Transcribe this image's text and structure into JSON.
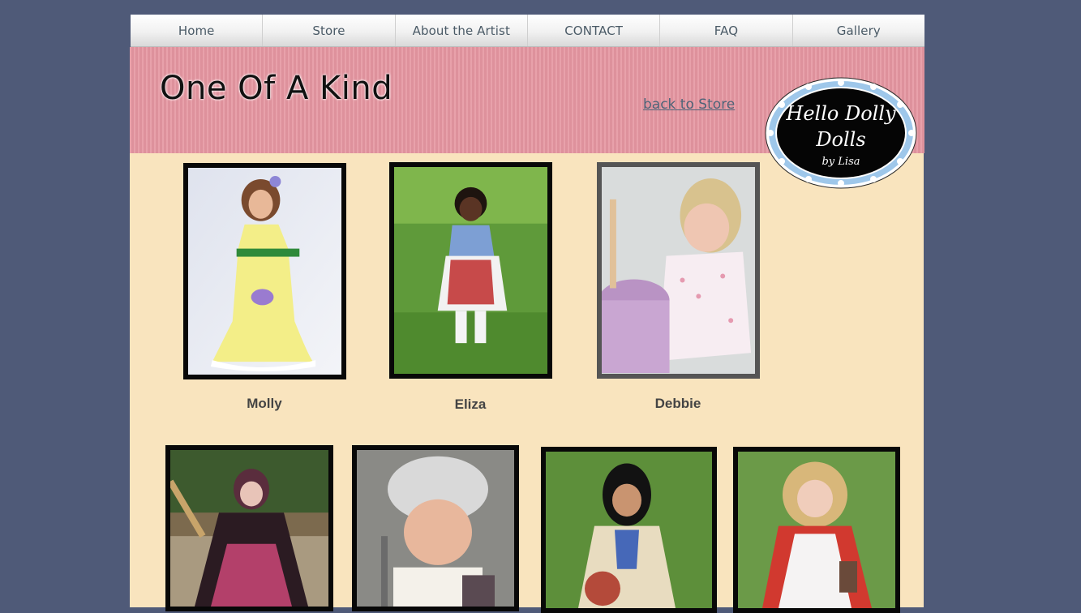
{
  "nav": {
    "items": [
      {
        "label": "Home"
      },
      {
        "label": "Store"
      },
      {
        "label": "About the Artist"
      },
      {
        "label": "CONTACT"
      },
      {
        "label": "FAQ"
      },
      {
        "label": "Gallery"
      }
    ]
  },
  "banner": {
    "title": "One Of A Kind",
    "back_link": "back to Store",
    "logo": {
      "line1": "Hello Dolly",
      "line2": "Dolls",
      "line3": "by Lisa"
    }
  },
  "gallery": {
    "row1": [
      {
        "name": "Molly"
      },
      {
        "name": "Eliza"
      },
      {
        "name": "Debbie"
      }
    ]
  },
  "colors": {
    "page_bg": "#4f5a78",
    "banner_pink": "#e596a1",
    "content_cream": "#f9e4be",
    "nav_text": "#4a5a66",
    "link": "#4e6478",
    "logo_ring": "#9ec7ea"
  }
}
